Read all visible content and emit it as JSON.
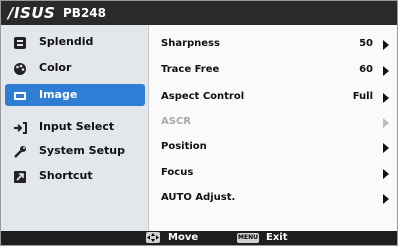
{
  "header": {
    "brand": "/ISUS",
    "model": "PB248"
  },
  "sidebar": {
    "items": [
      {
        "label": "Splendid",
        "icon": "splendid-icon"
      },
      {
        "label": "Color",
        "icon": "color-palette-icon"
      },
      {
        "label": "Image",
        "icon": "image-icon",
        "selected": true
      },
      {
        "label": "Input Select",
        "icon": "input-select-icon"
      },
      {
        "label": "System Setup",
        "icon": "wrench-icon"
      },
      {
        "label": "Shortcut",
        "icon": "shortcut-icon"
      }
    ]
  },
  "menu": {
    "rows": [
      {
        "label": "Sharpness",
        "value": "50",
        "enabled": true
      },
      {
        "label": "Trace Free",
        "value": "60",
        "enabled": true
      },
      {
        "label": "Aspect Control",
        "value": "Full",
        "enabled": true
      },
      {
        "label": "ASCR",
        "value": "",
        "enabled": false
      },
      {
        "label": "Position",
        "value": "",
        "enabled": true
      },
      {
        "label": "Focus",
        "value": "",
        "enabled": true
      },
      {
        "label": "AUTO Adjust.",
        "value": "",
        "enabled": true
      }
    ]
  },
  "footer": {
    "move_label": "Move",
    "menu_key": "MENU",
    "exit_label": "Exit"
  },
  "colors": {
    "accent": "#2f7dd4",
    "titlebar": "#2a2a2a",
    "footer": "#1e1e1e"
  }
}
